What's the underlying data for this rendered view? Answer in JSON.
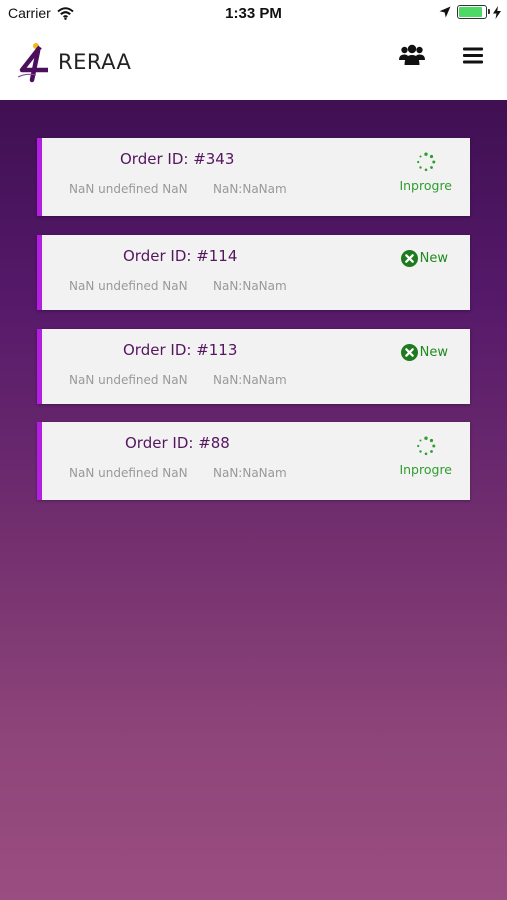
{
  "status_bar": {
    "carrier": "Carrier",
    "time": "1:33 PM",
    "battery_level": 0.9
  },
  "header": {
    "logo_text": "RERAA",
    "icons": [
      "users-icon",
      "menu-icon"
    ]
  },
  "colors": {
    "accent": "#b31fe0",
    "status_green": "#2e9e2e",
    "title": "#55165f",
    "bg_top": "#3f1052",
    "bg_bottom": "#9a4d80"
  },
  "orders": [
    {
      "title": "Order ID: #343",
      "date": "NaN undefined NaN",
      "time": "NaN:NaNam",
      "status": "Inprogre",
      "status_icon": "spinner-icon"
    },
    {
      "title": "Order ID: #114",
      "date": "NaN undefined NaN",
      "time": "NaN:NaNam",
      "status": "New",
      "status_icon": "close-circle-icon"
    },
    {
      "title": "Order ID: #113",
      "date": "NaN undefined NaN",
      "time": "NaN:NaNam",
      "status": "New",
      "status_icon": "close-circle-icon"
    },
    {
      "title": "Order ID: #88",
      "date": "NaN undefined NaN",
      "time": "NaN:NaNam",
      "status": "Inprogre",
      "status_icon": "spinner-icon"
    }
  ]
}
